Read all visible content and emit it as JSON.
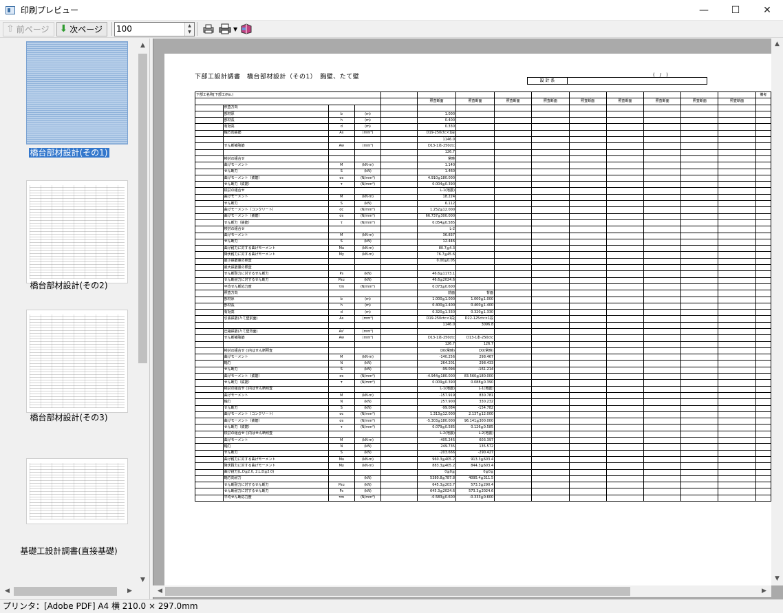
{
  "window": {
    "title": "印刷プレビュー",
    "minimize": "—",
    "maximize": "☐",
    "close": "✕"
  },
  "toolbar": {
    "prev_label": "前ページ",
    "next_label": "次ページ",
    "zoom_value": "100",
    "spin_up": "▲",
    "spin_down": "▼",
    "dropdown_arrow": "▼"
  },
  "thumbnails": [
    {
      "label": "橋台部材設計(その1)",
      "selected": true
    },
    {
      "label": "橋台部材設計(その2)",
      "selected": false
    },
    {
      "label": "橋台部材設計(その3)",
      "selected": false
    },
    {
      "label": "基礎工設計調書(直接基礎)",
      "selected": false
    }
  ],
  "document": {
    "title": "下部工設計調書　橋台部材設計（その1）　胸壁、たて壁",
    "page_no": "(　/　)",
    "meta_label": "設 計 条",
    "header_left": "下部工名称[下部工(No.)",
    "header_right": "備考",
    "column_labels": [
      "照査断面",
      "照査断面",
      "照査断面",
      "照査断面",
      "照査断面",
      "照査断面",
      "照査断面",
      "照査断面",
      "照査断面"
    ],
    "rows": [
      [
        "照査方向",
        "",
        "",
        ""
      ],
      [
        "部材厚",
        "b",
        "(m)",
        "1.000"
      ],
      [
        "部材長",
        "h",
        "(m)",
        "0.400"
      ],
      [
        "有効高",
        "d",
        "(m)",
        "0.330"
      ],
      [
        "軸方向鉄筋",
        "As",
        "(mm²)",
        "D19-250ctc×1段"
      ],
      [
        "",
        "",
        "",
        "1146.0"
      ],
      [
        "せん断補強筋",
        "Aw",
        "(mm²)",
        "D13-1本-250ctc"
      ],
      [
        "",
        "",
        "",
        "126.7"
      ],
      [
        "検討の組合せ",
        "",
        "",
        "常時"
      ],
      [
        "曲げモーメント",
        "M",
        "(kN·m)",
        "1.140"
      ],
      [
        "せん断力",
        "S",
        "(kN)",
        "1.460"
      ],
      [
        "曲げモーメント（鉄筋）",
        "σs",
        "(N/mm²)",
        "4.910≦180.000"
      ],
      [
        "せん断力（鉄筋）",
        "τ",
        "(N/mm²)",
        "0.004≦0.390"
      ],
      [
        "検討の組合せ",
        "",
        "",
        "L-1(地震)"
      ],
      [
        "曲げモーメント",
        "M",
        "(kN·m)",
        "18.224"
      ],
      [
        "せん断力",
        "S",
        "(kN)",
        "6.112"
      ],
      [
        "曲げモーメント（コンクリート）",
        "σc",
        "(N/mm²)",
        "1.252≦12.000"
      ],
      [
        "曲げモーメント（鉄筋）",
        "σs",
        "(N/mm²)",
        "66.737≦300.000"
      ],
      [
        "せん断力（鉄筋）",
        "τ",
        "(N/mm²)",
        "0.054≦0.585"
      ],
      [
        "検討の組合せ",
        "",
        "",
        "L-2"
      ],
      [
        "曲げモーメント",
        "M",
        "(kN·m)",
        "36.837"
      ],
      [
        "せん断力",
        "S",
        "(kN)",
        "12.446"
      ],
      [
        "曲げ耐力に対する曲げモーメント",
        "Mu",
        "(kN·m)",
        "80.7≦4.3"
      ],
      [
        "降伏耐力に対する曲げモーメント",
        "My",
        "(kN·m)",
        "76.7≦45.6"
      ],
      [
        "最小鉄筋量の照査",
        "",
        "",
        "0.00≦0.05"
      ],
      [
        "最大鉄筋量の照査",
        "",
        "",
        ""
      ],
      [
        "せん断耐力に対するせん断力",
        "Ps",
        "(kN)",
        "46.6≦1173.1"
      ],
      [
        "せん断耐力に対するせん断力",
        "Psu",
        "(kN)",
        "46.6≦2024.6"
      ],
      [
        "平均せん断応力度",
        "τm",
        "(N/mm²)",
        "0.073≦0.600"
      ]
    ],
    "rows2": [
      [
        "照査方向",
        "",
        "",
        "前面",
        "背面"
      ],
      [
        "部材厚",
        "b",
        "(m)",
        "1.000≦1.000",
        "1.000≦1.000"
      ],
      [
        "部材長",
        "h",
        "(m)",
        "0.400≦1.400",
        "0.400≦1.400"
      ],
      [
        "有効高",
        "d",
        "(m)",
        "0.320≦1.330",
        "0.320≦1.330"
      ],
      [
        "引張鉄筋(たて壁前面)",
        "As",
        "(mm²)",
        "D19-250ctc×1段",
        "D22-125ctc×1段"
      ],
      [
        "",
        "",
        "",
        "1146.0",
        "3096.8"
      ],
      [
        "圧縮鉄筋(たて壁背面)",
        "As'",
        "(mm²)",
        "",
        ""
      ],
      [
        "せん断補強筋",
        "Aw",
        "(mm²)",
        "D13-1本-250ctc",
        "D13-1本-250ctc"
      ],
      [
        "",
        "",
        "",
        "126.7",
        "126.7"
      ],
      [
        "検討の組合せ ()内はせん断照査",
        "",
        "",
        "D0(常時)",
        "D0(常時)"
      ],
      [
        "曲げモーメント",
        "M",
        "(kN·m)",
        "-140.256",
        "298.467"
      ],
      [
        "軸力",
        "N",
        "(kN)",
        "264.201",
        "298.433"
      ],
      [
        "せん断力",
        "S",
        "(kN)",
        "-99.094",
        "-161.214"
      ],
      [
        "曲げモーメント（鉄筋）",
        "σs",
        "(N/mm²)",
        "-4.944≦180.000",
        "83.560≦180.000"
      ],
      [
        "せん断力（鉄筋）",
        "τ",
        "(N/mm²)",
        "0.009≦0.390",
        "0.088≦0.390"
      ],
      [
        "検討の組合せ ()内はせん断照査",
        "",
        "",
        "L-1(地震)",
        "L-1(地震)"
      ],
      [
        "曲げモーメント",
        "M",
        "(kN·m)",
        "-157.919",
        "830.781"
      ],
      [
        "軸力",
        "N",
        "(kN)",
        "257.900",
        "330.232"
      ],
      [
        "せん断力",
        "S",
        "(kN)",
        "-99.084",
        "-154.782"
      ],
      [
        "曲げモーメント（コンクリート）",
        "σc",
        "(N/mm²)",
        "1.313≦12.000",
        "2.137≦12.000"
      ],
      [
        "曲げモーメント（鉄筋）",
        "σs",
        "(N/mm²)",
        "-5.303≦180.000",
        "96.141≦300.000"
      ],
      [
        "せん断力（鉄筋）",
        "τ",
        "(N/mm²)",
        "0.079≦0.585",
        "0.126≦0.585"
      ],
      [
        "検討の組合せ ()内はせん断照査",
        "",
        "",
        "L-2(地震)",
        "L-2(地震)"
      ],
      [
        "曲げモーメント",
        "M",
        "(kN·m)",
        "-405.245",
        "603.397"
      ],
      [
        "軸力",
        "N",
        "(kN)",
        "249.735",
        "135.572"
      ],
      [
        "せん断力",
        "S",
        "(kN)",
        "-203.666",
        "-290.427"
      ],
      [
        "曲げ耐力に対する曲げモーメント",
        "Mu",
        "(kN·m)",
        "960.3≦405.2",
        "913.3≦603.4"
      ],
      [
        "降伏耐力に対する曲げモーメント",
        "My",
        "(kN·m)",
        "883.3≦405.2",
        "844.3≦603.4"
      ],
      [
        "曲げ耐力(L.D≦2.0, 2.L.D≦2.0)",
        "",
        "",
        "0≦0≦",
        "0≦0≦"
      ],
      [
        "軸方向耐力",
        "",
        "(kN)",
        "5380.8≦787.8",
        "4095.4≦311.5"
      ],
      [
        "せん断耐力に対するせん断力",
        "Psu",
        "(kN)",
        "645.3≦203.7",
        "573.3≦290.4"
      ],
      [
        "せん断耐力に対するせん断力",
        "Ps",
        "(kN)",
        "645.3≦2024.6",
        "573.3≦2024.6"
      ],
      [
        "平均せん断応力度",
        "τm",
        "(N/mm²)",
        "-0.583≦0.600",
        "-0.333≦0.600"
      ]
    ]
  },
  "status": {
    "text": "プリンタ：[Adobe PDF] A4 横  210.0 × 297.0mm"
  }
}
